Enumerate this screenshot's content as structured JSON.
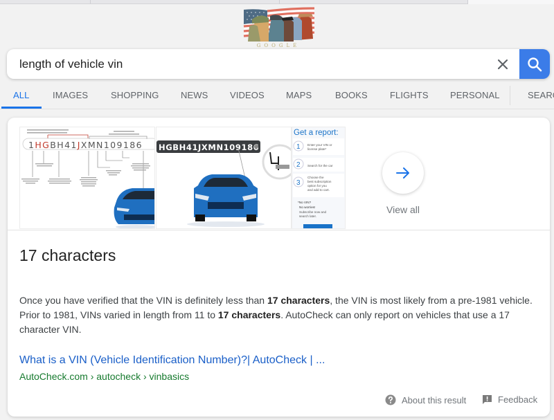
{
  "doodle": {
    "label": "GOOGLE",
    "icon": "veterans-day-doodle-logo"
  },
  "search": {
    "query": "length of vehicle vin",
    "placeholder": "",
    "clear_icon": "close-icon",
    "search_icon": "search-icon"
  },
  "tabs": [
    {
      "label": "ALL",
      "active": true
    },
    {
      "label": "IMAGES",
      "active": false
    },
    {
      "label": "SHOPPING",
      "active": false
    },
    {
      "label": "NEWS",
      "active": false
    },
    {
      "label": "VIDEOS",
      "active": false
    },
    {
      "label": "MAPS",
      "active": false
    },
    {
      "label": "BOOKS",
      "active": false
    },
    {
      "label": "FLIGHTS",
      "active": false
    },
    {
      "label": "PERSONAL",
      "active": false
    },
    {
      "label": "SEARCH TOOLS",
      "active": false
    }
  ],
  "images": {
    "thumb1": {
      "vin_chars": [
        "1",
        "H",
        "G",
        "B",
        "H",
        "4",
        "1",
        "J",
        "X",
        "M",
        "N",
        "1",
        "0",
        "9",
        "1",
        "8",
        "6"
      ],
      "highlight_color": "#c0392b"
    },
    "thumb2": {
      "vin_plate": "HGBH41JXMN109186"
    },
    "thumb3": {
      "title": "Get a report:",
      "steps": [
        {
          "num": "1",
          "text": "Enter your VIN or license plate*"
        },
        {
          "num": "2",
          "text": "Search for the car"
        },
        {
          "num": "3",
          "text": "Choose the best subscription option for you and add to cart."
        }
      ],
      "note_title": "*No VIN?",
      "note_line2": "No worries!",
      "note_body": "Subscribe now and search later."
    },
    "view_all_label": "View all",
    "view_all_icon": "arrow-right-icon"
  },
  "answer": {
    "title": "17 characters",
    "snippet_parts": [
      "Once you have verified that the VIN is definitely less than ",
      "17 characters",
      ", the VIN is most likely from a pre-1981 vehicle. Prior to 1981, VINs varied in length from 11 to ",
      "17 characters",
      ". AutoCheck can only report on vehicles that use a 17 character VIN."
    ]
  },
  "result": {
    "title": "What is a VIN (Vehicle Identification Number)?| AutoCheck | ...",
    "breadcrumb": "AutoCheck.com › autocheck › vinbasics"
  },
  "footer": {
    "about_label": "About this result",
    "about_icon": "help-circle-icon",
    "feedback_label": "Feedback",
    "feedback_icon": "feedback-icon"
  },
  "colors": {
    "accent": "#1a73e8",
    "search_button": "#3b7ce8",
    "link": "#1a5fc8",
    "url_green": "#167a2e",
    "car_blue": "#1f6fc0"
  }
}
